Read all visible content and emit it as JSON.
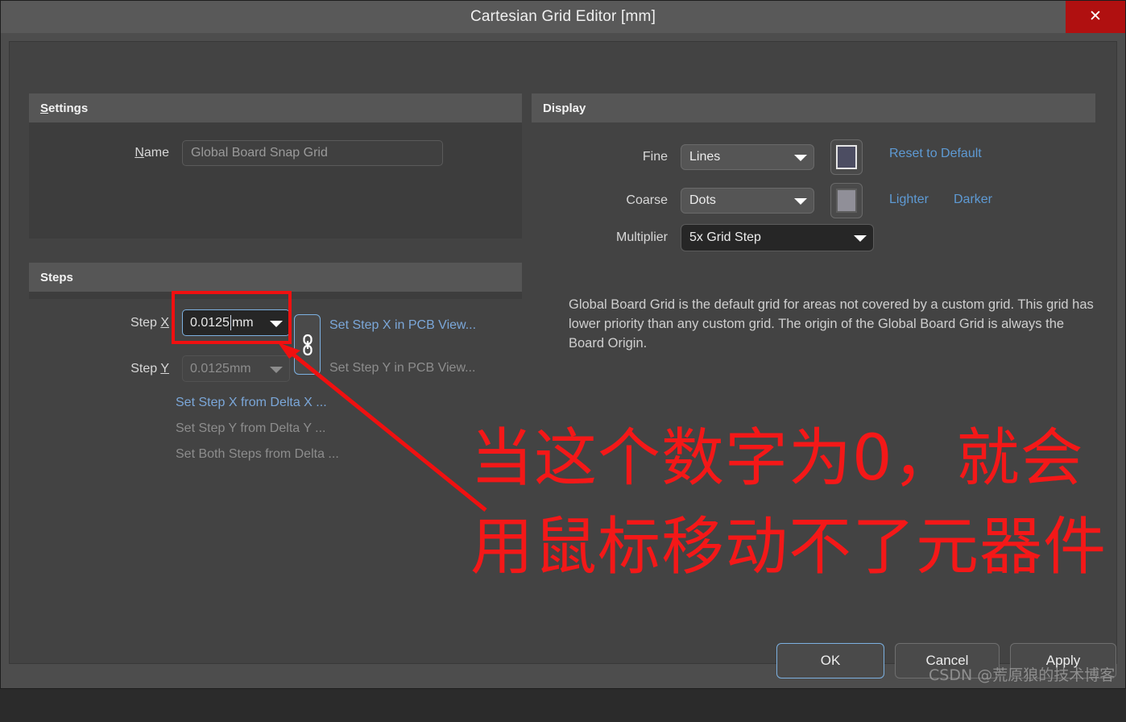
{
  "window": {
    "title": "Cartesian Grid Editor [mm]",
    "close_label": "✕"
  },
  "settings": {
    "group_title_accel": "S",
    "group_title_rest": "ettings",
    "name_label_accel": "N",
    "name_label_rest": "ame",
    "name_value": "Global Board Snap Grid"
  },
  "steps": {
    "group_title": "Steps",
    "step_x_label_pre": "Step ",
    "step_x_label_accel": "X",
    "step_y_label_pre": "Step ",
    "step_y_label_accel": "Y",
    "step_x_value": "0.0125",
    "step_x_unit": "mm",
    "step_y_value": "0.0125mm",
    "link_icon": "chain-link-icon",
    "links": {
      "set_step_x_pcb": "Set Step X in PCB View...",
      "set_step_y_pcb": "Set Step Y in PCB View...",
      "set_step_x_delta": "Set Step X from Delta X ...",
      "set_step_y_delta": "Set Step Y from Delta Y ...",
      "set_both_delta": "Set Both Steps from Delta ..."
    }
  },
  "display": {
    "group_title": "Display",
    "fine_label": "Fine",
    "fine_value": "Lines",
    "fine_color": "#4c4d62",
    "coarse_label": "Coarse",
    "coarse_value": "Dots",
    "coarse_color": "#908f98",
    "multiplier_label": "Multiplier",
    "multiplier_value": "5x Grid Step",
    "reset_link": "Reset to Default",
    "lighter_link": "Lighter",
    "darker_link": "Darker",
    "description": "Global Board Grid is the default grid for areas not covered by a custom grid. This grid has lower priority than any custom grid. The origin of the Global Board Grid is always the Board Origin."
  },
  "footer": {
    "ok_label": "OK",
    "cancel_label": "Cancel",
    "apply_label": "Apply"
  },
  "annotation": {
    "note_text": "当这个数字为0，就会用鼠标移动不了元器件",
    "highlight_color": "#f01010",
    "watermark": "CSDN @荒原狼的技术博客"
  }
}
